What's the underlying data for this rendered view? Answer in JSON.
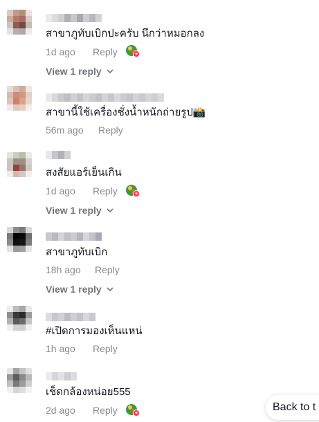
{
  "comments": [
    {
      "text": "สาขาภูทับเบิกปะครับ นึกว่าหมอกลง",
      "time": "1d ago",
      "reply_label": "Reply",
      "has_reaction_icon": true,
      "view_replies": "View 1 reply"
    },
    {
      "text": "สาขานี้ใช้เครื่องชั่งน้ำหนักถ่ายรูป📸",
      "time": "56m ago",
      "reply_label": "Reply",
      "has_reaction_icon": false,
      "view_replies": ""
    },
    {
      "text": "สงสัยแอร์เย็นเกิน",
      "time": "1d ago",
      "reply_label": "Reply",
      "has_reaction_icon": true,
      "view_replies": "View 1 reply"
    },
    {
      "text": "สาขาภูทับเบิก",
      "time": "18h ago",
      "reply_label": "Reply",
      "has_reaction_icon": false,
      "view_replies": "View 1 reply"
    },
    {
      "text": "#เปิดการมองเห็นแหน่",
      "time": "1h ago",
      "reply_label": "Reply",
      "has_reaction_icon": false,
      "view_replies": ""
    },
    {
      "text": "เช็ดกล้องหน่อย555",
      "time": "2d ago",
      "reply_label": "Reply",
      "has_reaction_icon": true,
      "view_replies": ""
    }
  ],
  "back_to_top": "Back to t",
  "colors": {
    "text": "#161823",
    "meta": "#8a8b91",
    "view_reply": "#73757c"
  },
  "icons": {
    "reaction": "creator-liked-icon",
    "chevron": "chevron-down-icon"
  }
}
